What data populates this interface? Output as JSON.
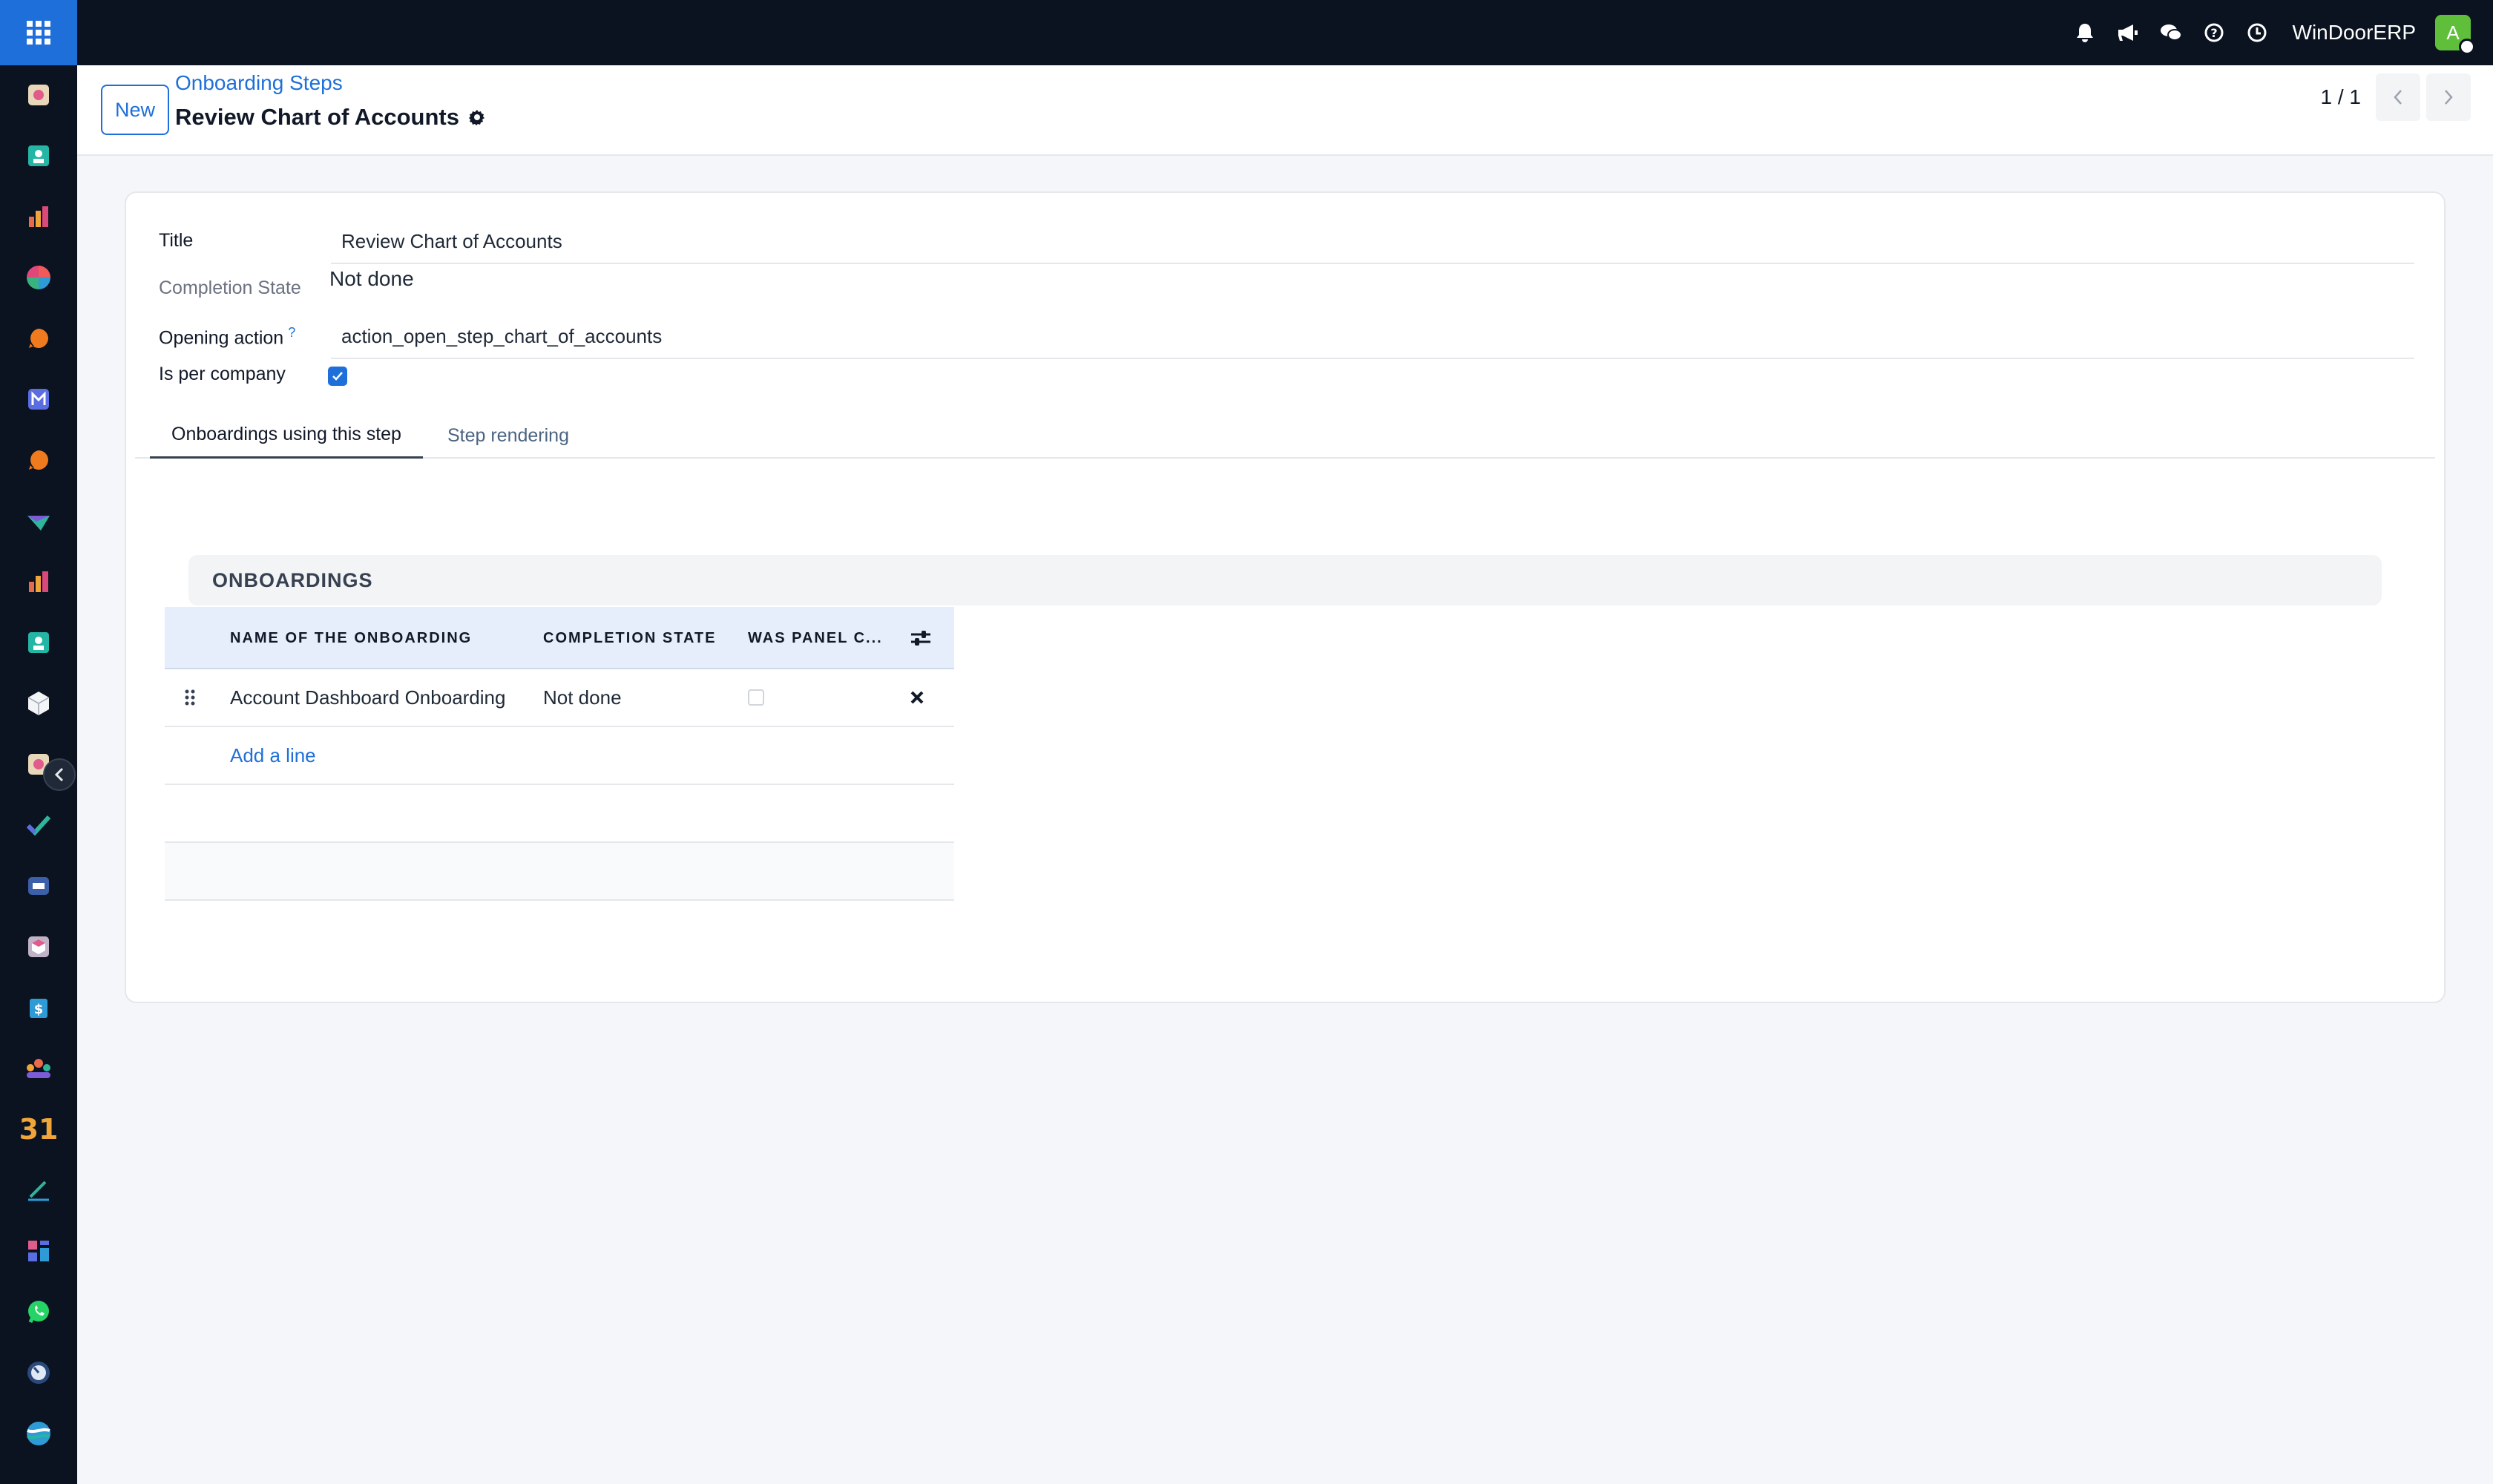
{
  "topbar": {
    "brand": "WinDoorERP",
    "avatar_initial": "A",
    "icons": [
      "bell-icon",
      "megaphone-icon",
      "chat-icon",
      "help-icon",
      "clock-icon"
    ]
  },
  "sidebar": {
    "items": [
      "app-icon-1",
      "app-icon-2",
      "app-icon-3",
      "app-icon-4",
      "app-icon-5",
      "app-icon-6",
      "app-icon-7",
      "app-icon-8",
      "app-icon-9",
      "app-icon-10",
      "app-icon-11",
      "app-icon-12",
      "app-icon-13",
      "app-icon-14",
      "app-icon-15",
      "app-icon-16",
      "app-icon-17",
      "app-icon-18",
      "app-icon-19",
      "app-icon-20",
      "app-icon-21",
      "app-icon-22",
      "app-icon-23"
    ],
    "calendar_label": "31"
  },
  "control": {
    "new_label": "New",
    "breadcrumb": "Onboarding Steps",
    "title": "Review Chart of Accounts",
    "pager": "1 / 1"
  },
  "form": {
    "title_label": "Title",
    "title_value": "Review Chart of Accounts",
    "completion_label": "Completion State",
    "completion_value": "Not done",
    "opening_action_label": "Opening action",
    "opening_action_help": "?",
    "opening_action_value": "action_open_step_chart_of_accounts",
    "per_company_label": "Is per company",
    "per_company_checked": true
  },
  "tabs": [
    {
      "label": "Onboardings using this step",
      "active": true
    },
    {
      "label": "Step rendering",
      "active": false
    }
  ],
  "onboardings": {
    "group_title": "ONBOARDINGS",
    "columns": [
      "NAME OF THE ONBOARDING",
      "COMPLETION STATE",
      "WAS PANEL C..."
    ],
    "rows": [
      {
        "name": "Account Dashboard Onboarding",
        "state": "Not done",
        "panel_closed": false
      }
    ],
    "add_line": "Add a line"
  },
  "colors": {
    "accent": "#1e6fd9",
    "topbar": "#0b1220",
    "avatar": "#5fbf3b"
  }
}
